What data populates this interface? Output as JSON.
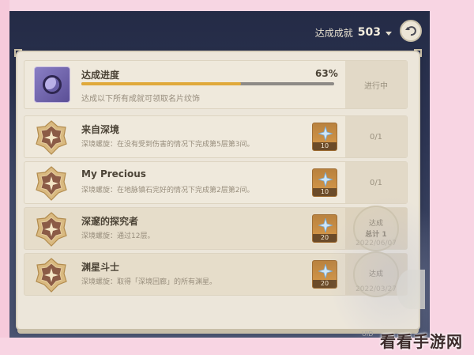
{
  "header": {
    "total_label": "达成成就",
    "total_count": "503"
  },
  "progress": {
    "title": "达成进度",
    "percent_text": "63%",
    "fraction": 0.63,
    "description": "达成以下所有成就可领取名片纹饰",
    "status": "进行中"
  },
  "achievements": [
    {
      "title": "来自深境",
      "description": "深境螺旋：在没有受到伤害的情况下完成第5层第3间。",
      "reward_qty": "10",
      "status": "0/1",
      "done": false
    },
    {
      "title": "My Precious",
      "description": "深境螺旋：在地脉镇石完好的情况下完成第2层第2间。",
      "reward_qty": "10",
      "status": "0/1",
      "done": false
    },
    {
      "title": "深邃的探究者",
      "description": "深境螺旋：通过12层。",
      "reward_qty": "20",
      "seal_label": "达成",
      "seal_sub": "总计 1",
      "date": "2022/06/07",
      "done": true
    },
    {
      "title": "渊星斗士",
      "description": "深境螺旋：取得「深境回廊」的所有渊星。",
      "reward_qty": "20",
      "seal_label": "达成",
      "date": "2022/03/27",
      "done": true
    }
  ],
  "watermark": "看看手游网",
  "uid_text": "UID"
}
